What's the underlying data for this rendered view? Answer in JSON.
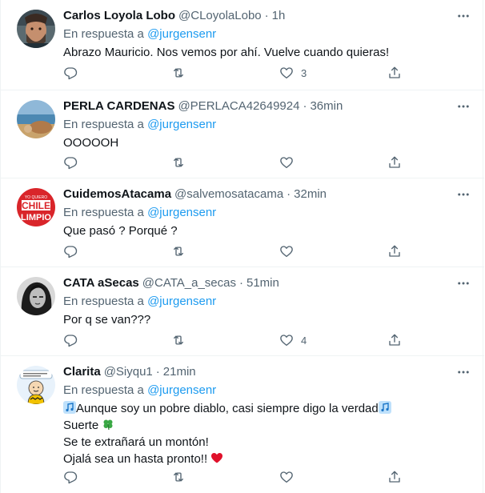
{
  "tweets": [
    {
      "name": "Carlos Loyola Lobo",
      "handle": "@CLoyolaLobo",
      "separator": "·",
      "time": "1h",
      "reply_prefix": "En respuesta a",
      "reply_mention": "@jurgensenr",
      "text": "Abrazo Mauricio. Nos vemos por ahí. Vuelve cuando quieras!",
      "like_count": "3",
      "avatar": "man-with-beard-avatar"
    },
    {
      "name": "PERLA CARDENAS",
      "handle": "@PERLACA42649924",
      "separator": "·",
      "time": "36min",
      "reply_prefix": "En respuesta a",
      "reply_mention": "@jurgensenr",
      "text": "OOOOOH",
      "like_count": "",
      "avatar": "beach-landscape-avatar"
    },
    {
      "name": "CuidemosAtacama",
      "handle": "@salvemosatacama",
      "separator": "·",
      "time": "32min",
      "reply_prefix": "En respuesta a",
      "reply_mention": "@jurgensenr",
      "text": "Que pasó ? Porqué ?",
      "like_count": "",
      "avatar": "chile-limpio-logo-avatar",
      "avatar_text": [
        "YO QUIERO",
        "CHILE",
        "LIMPIO"
      ]
    },
    {
      "name": "CATA aSecas",
      "handle": "@CATA_a_secas",
      "separator": "·",
      "time": "51min",
      "reply_prefix": "En respuesta a",
      "reply_mention": "@jurgensenr",
      "text": "Por q se van???",
      "like_count": "4",
      "avatar": "woman-bw-portrait-avatar"
    },
    {
      "name": "Clarita",
      "handle": "@Siyqu1",
      "separator": "·",
      "time": "21min",
      "reply_prefix": "En respuesta a",
      "reply_mention": "@jurgensenr",
      "lines": [
        "Aunque soy un pobre diablo, casi siempre digo la verdad",
        "Suerte",
        "Se te extrañará un montón!",
        "Ojalá sea un hasta pronto!!"
      ],
      "like_count": "",
      "avatar": "cartoon-charlie-brown-avatar"
    }
  ],
  "colors": {
    "text": "#0f1419",
    "secondary": "#536471",
    "link": "#1d9bf0",
    "border": "#eff3f4",
    "heart": "#f91880"
  },
  "icons": [
    "reply-icon",
    "retweet-icon",
    "like-icon",
    "share-icon",
    "more-icon"
  ]
}
